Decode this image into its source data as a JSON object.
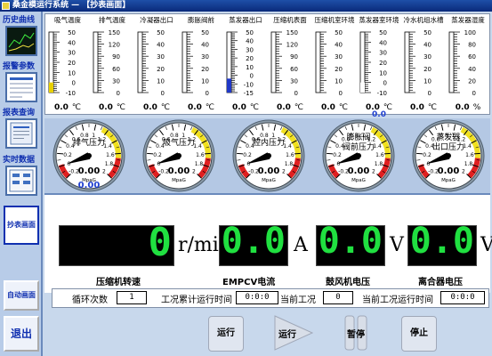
{
  "title": "桑金模运行系统 — 【抄表画面】",
  "sidebar": {
    "items": [
      {
        "label": "历史曲线"
      },
      {
        "label": "报警参数"
      },
      {
        "label": "报表查询"
      },
      {
        "label": "实时数据"
      },
      {
        "label": "抄表画面"
      },
      {
        "label": "自动画面"
      },
      {
        "label": "退出"
      }
    ]
  },
  "thermometers": [
    {
      "label": "吸气温度",
      "ticks": [
        "50",
        "40",
        "30",
        "20",
        "10",
        "0",
        "-10"
      ],
      "min": -10,
      "max": 50,
      "level": 0,
      "fill": "#e8d000",
      "value": "0.0",
      "unit": "℃"
    },
    {
      "label": "排气温度",
      "ticks": [
        "150",
        "120",
        "90",
        "60",
        "30",
        "0"
      ],
      "min": 0,
      "max": 150,
      "level": 0,
      "fill": "#ffffff",
      "value": "0.0",
      "unit": "℃"
    },
    {
      "label": "冷凝器出口",
      "ticks": [
        "50",
        "40",
        "30",
        "20",
        "10",
        "0"
      ],
      "min": 0,
      "max": 50,
      "level": 0,
      "fill": "#ffffff",
      "value": "0.0",
      "unit": "℃"
    },
    {
      "label": "膨胀阀前",
      "ticks": [
        "50",
        "40",
        "30",
        "20",
        "10",
        "0"
      ],
      "min": 0,
      "max": 50,
      "level": 0,
      "fill": "#ffffff",
      "value": "0.0",
      "unit": "℃"
    },
    {
      "label": "蒸发器出口",
      "ticks": [
        "50",
        "40",
        "30",
        "20",
        "10",
        "0",
        "-10",
        "-15"
      ],
      "min": -15,
      "max": 50,
      "level": 0,
      "fill": "#2038c8",
      "value": "0.0",
      "unit": "℃"
    },
    {
      "label": "压缩机表面",
      "ticks": [
        "150",
        "120",
        "90",
        "60",
        "30",
        "0"
      ],
      "min": 0,
      "max": 150,
      "level": 0,
      "fill": "#ffffff",
      "value": "0.0",
      "unit": "℃"
    },
    {
      "label": "压缩机室环境",
      "ticks": [
        "50",
        "40",
        "30",
        "20",
        "10",
        "0"
      ],
      "min": 0,
      "max": 50,
      "level": 0,
      "fill": "#ffffff",
      "value": "0.0",
      "unit": "℃"
    },
    {
      "label": "蒸发器室环境",
      "ticks": [
        "50",
        "40",
        "30",
        "20",
        "10",
        "0",
        "-10"
      ],
      "min": -10,
      "max": 50,
      "level": 0,
      "fill": "#ffffff",
      "value": "0.0",
      "value2": "0.0",
      "unit": "℃"
    },
    {
      "label": "冷水机组水槽",
      "ticks": [
        "50",
        "40",
        "30",
        "20",
        "10",
        "0"
      ],
      "min": 0,
      "max": 50,
      "level": 0,
      "fill": "#ffffff",
      "value": "0.0",
      "unit": "℃"
    },
    {
      "label": "蒸发器湿度",
      "ticks": [
        "100",
        "80",
        "60",
        "40",
        "20",
        "0"
      ],
      "min": 0,
      "max": 100,
      "level": 0,
      "fill": "#303030",
      "value": "0.0",
      "unit": "%"
    }
  ],
  "pressure_gauges": [
    {
      "name": "排气压力",
      "line2": "",
      "ticks": [
        "-0.2",
        "0",
        "0.2",
        "0.4",
        "0.6",
        "0.8",
        "1",
        "1.2",
        "1.4",
        "1.6",
        "1.8",
        "2"
      ],
      "unit": "MpaG",
      "value": "0.00",
      "value2": "0.00"
    },
    {
      "name": "吸气压力",
      "line2": "",
      "ticks": [
        "-0.2",
        "0",
        "0.2",
        "0.4",
        "0.6",
        "0.8",
        "1",
        "1.2",
        "1.4",
        "1.6",
        "1.8",
        "2"
      ],
      "unit": "MpaG",
      "value": "0.00",
      "value2": ""
    },
    {
      "name": "腔内压力",
      "line2": "",
      "ticks": [
        "-0.2",
        "0",
        "0.2",
        "0.4",
        "0.6",
        "0.8",
        "1",
        "1.2",
        "1.4",
        "1.6",
        "1.8",
        "2"
      ],
      "unit": "MpaG",
      "value": "0.00",
      "value2": ""
    },
    {
      "name": "膨胀阀",
      "line2": "阀前压力",
      "ticks": [
        "-0.2",
        "0",
        "0.2",
        "0.4",
        "0.6",
        "0.8",
        "1",
        "1.2",
        "1.4",
        "1.6",
        "1.8",
        "2"
      ],
      "unit": "MpaG",
      "value": "0.00",
      "value2": ""
    },
    {
      "name": "蒸发器",
      "line2": "出口压力",
      "ticks": [
        "-0.2",
        "0",
        "0.2",
        "0.4",
        "0.6",
        "0.8",
        "1",
        "1.2",
        "1.4",
        "1.6",
        "1.8",
        "2"
      ],
      "unit": "MpaG",
      "value": "0.00",
      "value2": ""
    }
  ],
  "digital_readouts": [
    {
      "value": "0",
      "unit": "r/min",
      "label": "压缩机转速"
    },
    {
      "value": "0.0",
      "unit": "A",
      "label": "EMPCV电流"
    },
    {
      "value": "0.0",
      "unit": "V",
      "label": "鼓风机电压"
    },
    {
      "value": "0.0",
      "unit": "V",
      "label": "离合器电压"
    }
  ],
  "status": {
    "cycle_label": "循环次数",
    "cycle_value": "1",
    "total_time_label": "工况累计运行时间",
    "total_time_value": "0:0:0",
    "current_mode_label": "当前工况",
    "current_mode_value": "0",
    "current_time_label": "当前工况运行时间",
    "current_time_value": "0:0:0"
  },
  "controls": {
    "run1": "运行",
    "run2": "运行",
    "pause": "暂停",
    "stop": "停止"
  }
}
